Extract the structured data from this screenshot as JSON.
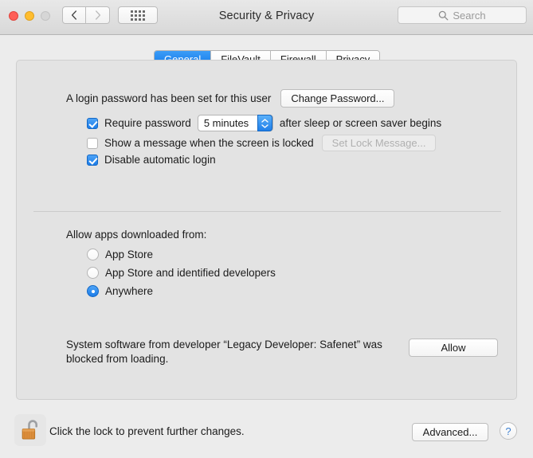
{
  "window": {
    "title": "Security & Privacy",
    "traffic_lights": [
      {
        "name": "close",
        "color": "#ff5f57",
        "enabled": true
      },
      {
        "name": "minimize",
        "color": "#ffbd2e",
        "enabled": true
      },
      {
        "name": "zoom",
        "color": "#d6d6d6",
        "enabled": false
      }
    ],
    "nav": {
      "back_icon": "chevron-left-icon",
      "forward_icon": "chevron-right-icon"
    },
    "show_all_icon": "grid-dots-icon",
    "search": {
      "placeholder": "Search",
      "value": "",
      "icon": "search-icon"
    }
  },
  "tabs": [
    {
      "label": "General",
      "active": true
    },
    {
      "label": "FileVault",
      "active": false
    },
    {
      "label": "Firewall",
      "active": false
    },
    {
      "label": "Privacy",
      "active": false
    }
  ],
  "general": {
    "login_password_text": "A login password has been set for this user",
    "change_password_label": "Change Password...",
    "require_password": {
      "checked": true,
      "label_before": "Require password",
      "interval_value": "5 minutes",
      "label_after": "after sleep or screen saver begins"
    },
    "show_message": {
      "checked": false,
      "label": "Show a message when the screen is locked",
      "button_label": "Set Lock Message...",
      "button_disabled": true
    },
    "disable_auto_login": {
      "checked": true,
      "label": "Disable automatic login"
    },
    "allow_apps": {
      "title": "Allow apps downloaded from:",
      "options": [
        {
          "label": "App Store",
          "selected": false
        },
        {
          "label": "App Store and identified developers",
          "selected": false
        },
        {
          "label": "Anywhere",
          "selected": true
        }
      ]
    },
    "blocked_notice": {
      "text": "System software from developer “Legacy Developer: Safenet” was blocked from loading.",
      "button_label": "Allow"
    }
  },
  "footer": {
    "lock_icon": "unlocked-padlock-icon",
    "lock_text": "Click the lock to prevent further changes.",
    "advanced_label": "Advanced...",
    "help_label": "?"
  },
  "colors": {
    "accent_blue": "#1c7ce8",
    "window_bg": "#ececec",
    "panel_bg": "#e3e3e3",
    "lock_orange": "#e08a33"
  }
}
